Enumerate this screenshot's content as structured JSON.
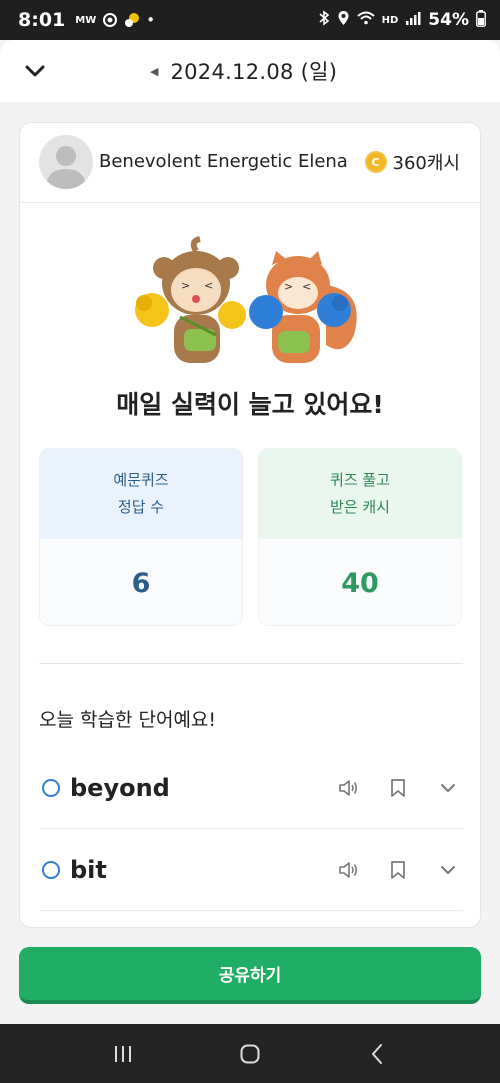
{
  "status_bar": {
    "time": "8:01",
    "carrier_badge": "MW",
    "battery": "54%",
    "hd_label": "HD"
  },
  "header": {
    "date": "2024.12.08 (일)"
  },
  "profile": {
    "name": "Benevolent Energetic Elena",
    "cash": "360캐시"
  },
  "headline": "매일 실력이 늘고 있어요!",
  "stats": {
    "quiz_label_line1": "예문퀴즈",
    "quiz_label_line2": "정답 수",
    "quiz_value": "6",
    "cash_label_line1": "퀴즈 풀고",
    "cash_label_line2": "받은 캐시",
    "cash_value": "40"
  },
  "words_section": {
    "title": "오늘 학습한 단어예요!",
    "words": [
      {
        "word": "beyond"
      },
      {
        "word": "bit"
      }
    ]
  },
  "share_button": "공유하기",
  "colors": {
    "accent_green": "#1fae63",
    "accent_blue": "#2f7ed8",
    "stat_blue_text": "#2c5d8a",
    "stat_green_text": "#2d9a62"
  }
}
